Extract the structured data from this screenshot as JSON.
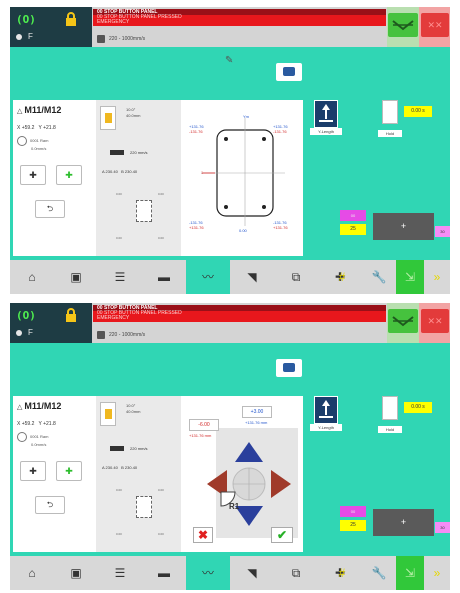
{
  "app": {
    "status_glyph": "(O)",
    "menu_glyph": "F",
    "alarm_title": "00 STOP BUTTON PANEL",
    "alarm_text": "00 STOP BUTTON PANEL PRESSED",
    "alarm_sub": "EMERGENCY",
    "program_name": "220 - 1000mm/s",
    "accent": "#30d6b4"
  },
  "part": {
    "name": "M11/M12",
    "x_coord": "X +59.2",
    "y_coord": "Y +21.8",
    "tool_line1": "0001 Ram",
    "tool_line2": "0.0mm/s",
    "feed": "220 mm/s",
    "dim_a": "A 230.40",
    "dim_b": "B 230.40",
    "lang_val": "10.0°",
    "lang_val2": "40.0mm",
    "mini_tl": "0.00",
    "mini_tr": "0.00",
    "mini_bl": "0.00",
    "mini_br": "0.00"
  },
  "drawing": {
    "top_label": "Ym",
    "tl1": "+131.76",
    "tl2": "-131.76",
    "tr1": "+131.76",
    "tr2": "-131.76",
    "mid_label": "1",
    "bl1": "-131.76",
    "bl2": "+131.76",
    "br1": "-131.76",
    "br2": "+131.76",
    "b_label": "0.00"
  },
  "right": {
    "radius_label": "Y-Length",
    "gear_label": "Hold",
    "time": "0.00 s",
    "purple": "00",
    "yellow": "25",
    "grey_sign": "+",
    "pink": "30"
  },
  "screen2": {
    "val_right": "+3.00",
    "val_left": "-6.00",
    "val_left_sub": "+131.76 mm",
    "val_right_sub": "+131.76 mm",
    "r1": "R1",
    "cancel": "✖",
    "ok": "✔"
  },
  "icons": [
    "home-icon",
    "page-icon",
    "program-icon",
    "tool-icon",
    "line-icon",
    "dragon-icon",
    "bracket-icon",
    "add-icon",
    "grid-icon",
    "wrench-icon",
    "compress-icon",
    "forward-icon"
  ]
}
